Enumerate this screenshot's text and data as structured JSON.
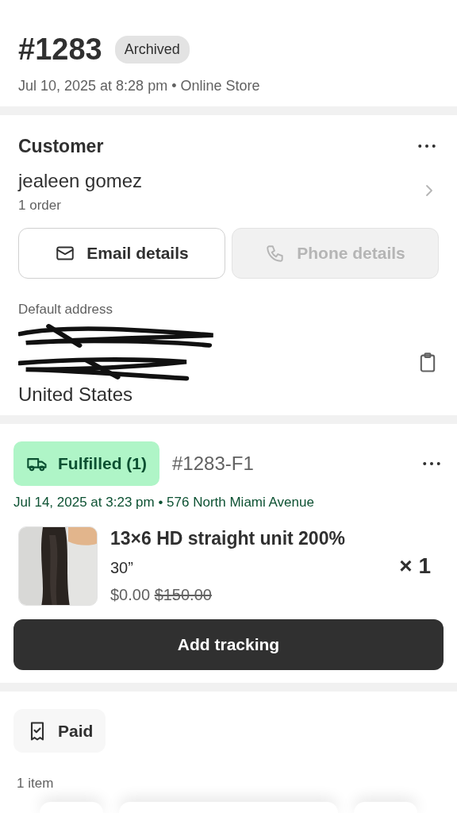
{
  "order": {
    "number": "#1283",
    "badge": "Archived",
    "meta": "Jul 10, 2025 at 8:28 pm • Online Store"
  },
  "customer": {
    "title": "Customer",
    "name": "jealeen gomez",
    "orders": "1 order",
    "buttons": [
      {
        "label": "Email details",
        "kind": "email",
        "disabled": false
      },
      {
        "label": "Phone details",
        "kind": "phone",
        "disabled": true
      }
    ],
    "address_label": "Default address",
    "country": "United States"
  },
  "fulfillment": {
    "status": "Fulfilled (1)",
    "id": "#1283-F1",
    "meta": "Jul 14, 2025 at 3:23 pm • 576 North Miami Avenue",
    "item": {
      "kind": "picture",
      "title": "13×6 HD straight unit 200%",
      "variant": "30”",
      "price": "$0.00",
      "original_price": "$150.00",
      "quantity": "× 1"
    },
    "action": "Add tracking"
  },
  "payment": {
    "status": "Paid",
    "items": "1 item"
  }
}
